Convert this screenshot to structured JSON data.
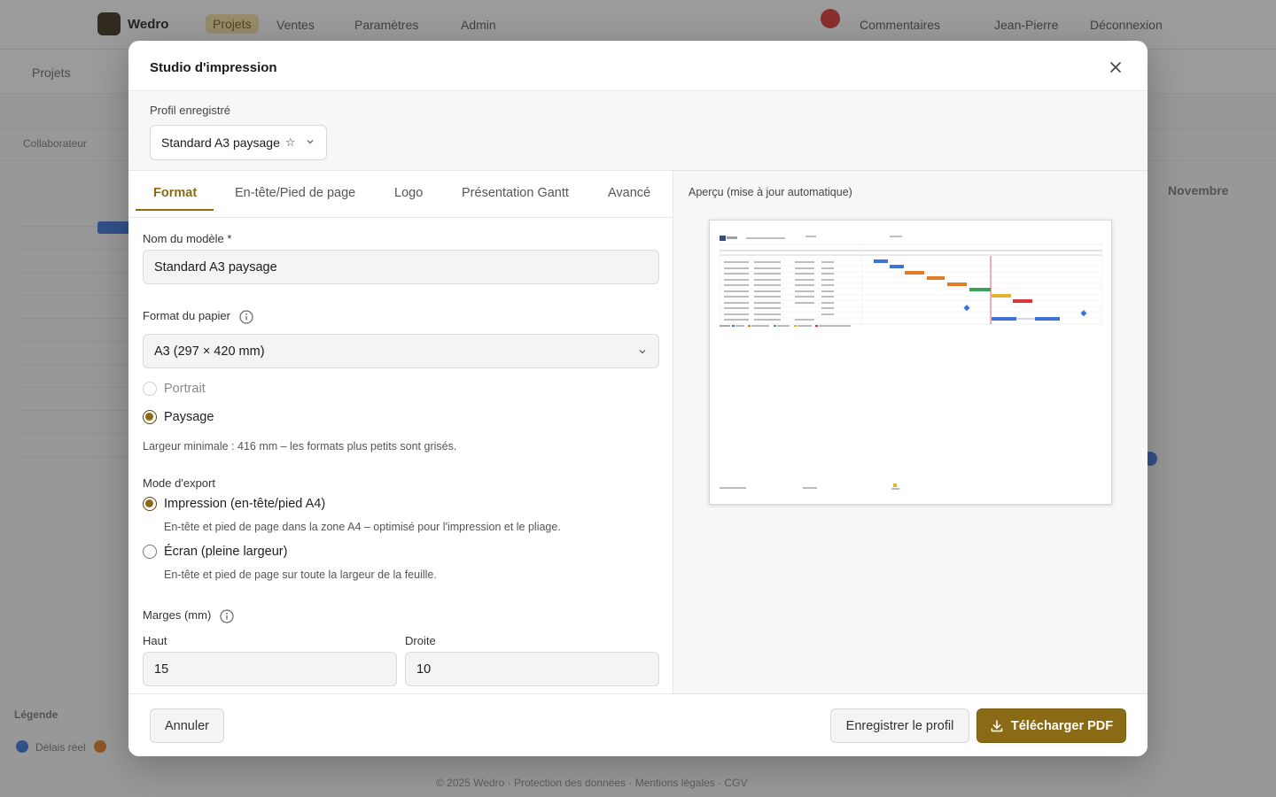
{
  "background": {
    "brand": "Wedro",
    "nav": [
      "Projets",
      "Ventes",
      "Paramètres",
      "Admin"
    ],
    "right_items": [
      "Commentaires",
      "Jean-Pierre",
      "Déconnexion"
    ],
    "breadcrumb": "Projets",
    "toolbar_left": "Collaborateur",
    "month_right": "Novembre",
    "legend": "Légende",
    "legend_item": "Délais réel",
    "footer": "© 2025 Wedro · Protection des données · Mentions légales · CGV"
  },
  "modal": {
    "title": "Studio d'impression",
    "close_icon": "close-icon",
    "profile": {
      "label": "Profil enregistré",
      "selected": "Standard A3 paysage",
      "star": "☆"
    },
    "tabs": [
      {
        "label": "Format",
        "active": true
      },
      {
        "label": "En-tête/Pied de page",
        "active": false
      },
      {
        "label": "Logo",
        "active": false
      },
      {
        "label": "Présentation Gantt",
        "active": false
      },
      {
        "label": "Avancé",
        "active": false
      }
    ],
    "form": {
      "model_name_label": "Nom du modèle *",
      "model_name_value": "Standard A3 paysage",
      "paper_format_label": "Format du papier",
      "paper_format_value": "A3 (297 × 420 mm)",
      "orientation": {
        "portrait": "Portrait",
        "landscape": "Paysage",
        "selected": "landscape",
        "portrait_disabled": true
      },
      "min_width_note": "Largeur minimale : 416 mm – les formats plus petits sont grisés.",
      "export_mode_label": "Mode d'export",
      "export_modes": [
        {
          "label": "Impression (en-tête/pied A4)",
          "description": "En-tête et pied de page dans la zone A4 – optimisé pour l'impression et le pliage.",
          "selected": true
        },
        {
          "label": "Écran (pleine largeur)",
          "description": "En-tête et pied de page sur toute la largeur de la feuille.",
          "selected": false
        }
      ],
      "margins_label": "Marges (mm)",
      "margin_top_label": "Haut",
      "margin_top_value": "15",
      "margin_right_label": "Droite",
      "margin_right_value": "10"
    },
    "preview": {
      "label": "Aperçu (mise à jour automatique)"
    },
    "footer": {
      "cancel": "Annuler",
      "save_profile": "Enregistrer le profil",
      "download": "Télécharger PDF"
    },
    "colors": {
      "accent": "#8a6a14",
      "gantt_blue": "#3b73d9",
      "gantt_orange": "#e07b22",
      "gantt_green": "#3aa55a",
      "gantt_yellow": "#e2b52a",
      "gantt_red": "#d9363e"
    }
  }
}
